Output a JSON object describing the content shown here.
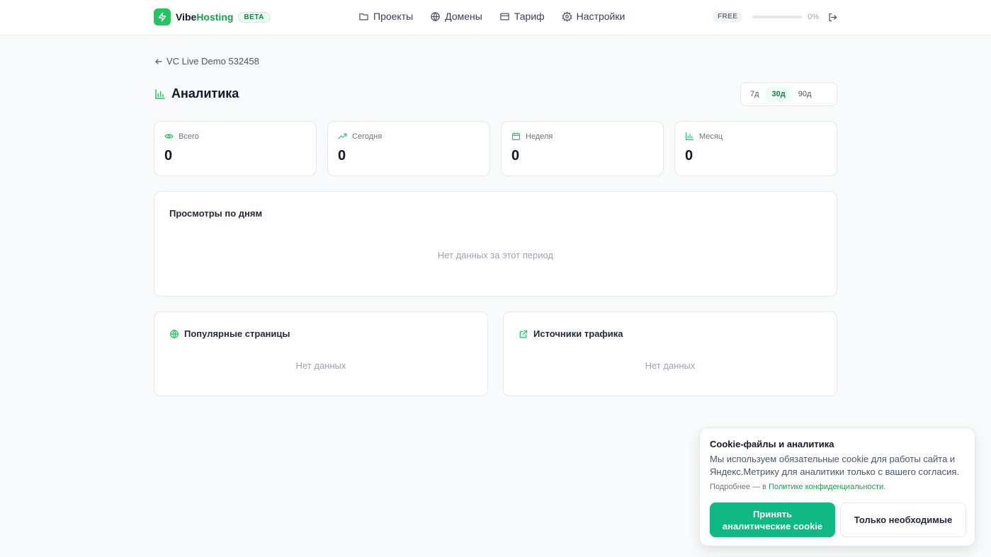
{
  "header": {
    "brand_part1": "Vibe",
    "brand_part2": "Hosting",
    "beta_label": "BETA",
    "nav": [
      {
        "label": "Проекты",
        "icon": "folder-icon"
      },
      {
        "label": "Домены",
        "icon": "globe-icon"
      },
      {
        "label": "Тариф",
        "icon": "credit-card-icon"
      },
      {
        "label": "Настройки",
        "icon": "gear-icon"
      }
    ],
    "plan_label": "FREE",
    "usage_percent_label": "0%",
    "usage_fraction": 0
  },
  "page": {
    "back_label": "VC Live Demo 532458",
    "title": "Аналитика",
    "periods": [
      {
        "label": "7д",
        "active": false
      },
      {
        "label": "30д",
        "active": true
      },
      {
        "label": "90д",
        "active": false
      }
    ]
  },
  "stats": [
    {
      "label": "Всего",
      "value": "0",
      "icon": "eye-icon"
    },
    {
      "label": "Сегодня",
      "value": "0",
      "icon": "trending-up-icon"
    },
    {
      "label": "Неделя",
      "value": "0",
      "icon": "calendar-icon"
    },
    {
      "label": "Месяц",
      "value": "0",
      "icon": "bar-chart-icon"
    }
  ],
  "views_chart": {
    "title": "Просмотры по дням",
    "empty_text": "Нет данных за этот период"
  },
  "popular_pages": {
    "title": "Популярные страницы",
    "empty_text": "Нет данных"
  },
  "traffic_sources": {
    "title": "Источники трафика",
    "empty_text": "Нет данных"
  },
  "cookie": {
    "title": "Cookie-файлы и аналитика",
    "text": "Мы используем обязательные cookie для работы сайта и Яндекс.Метрику для аналитики только с вашего согласия.",
    "note_prefix": "Подробнее — в ",
    "note_link": "Политике конфиденциальности",
    "note_suffix": ".",
    "accept_label": "Принять аналитические cookie",
    "minimal_label": "Только необходимые"
  },
  "colors": {
    "accent": "#22c55e",
    "accent_dark": "#16a34a",
    "button": "#10b981"
  }
}
